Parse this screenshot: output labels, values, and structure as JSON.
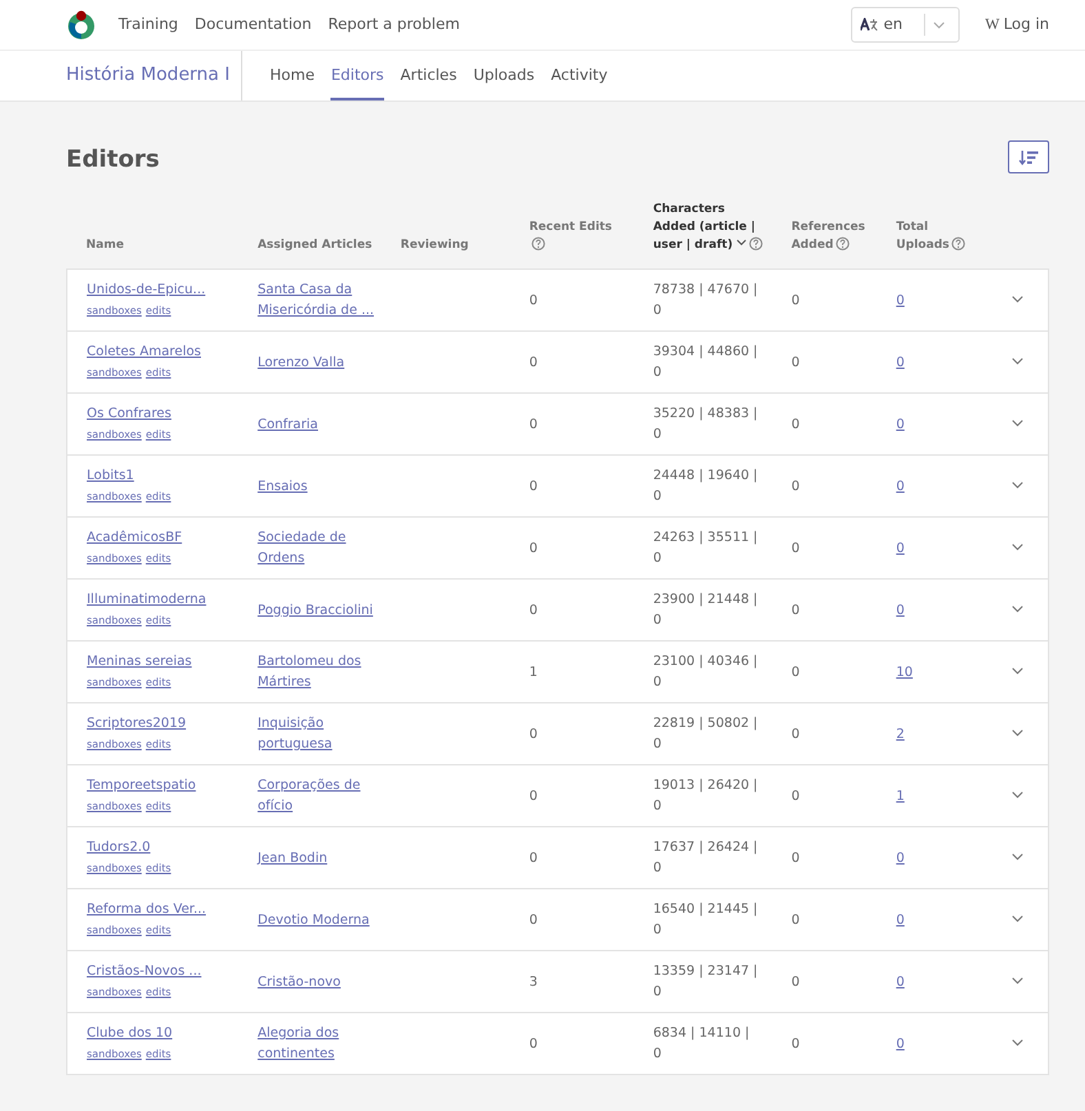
{
  "top_nav": {
    "links": [
      "Training",
      "Documentation",
      "Report a problem"
    ],
    "language": "en",
    "login_icon": "W",
    "login": "Log in"
  },
  "course_nav": {
    "title": "História Moderna I",
    "tabs": [
      {
        "label": "Home",
        "selected": false
      },
      {
        "label": "Editors",
        "selected": true
      },
      {
        "label": "Articles",
        "selected": false
      },
      {
        "label": "Uploads",
        "selected": false
      },
      {
        "label": "Activity",
        "selected": false
      }
    ]
  },
  "heading": "Editors",
  "table": {
    "columns": [
      {
        "label": "Name",
        "help": false,
        "sorted": false
      },
      {
        "label": "Assigned Articles",
        "help": false,
        "sorted": false
      },
      {
        "label": "Reviewing",
        "help": false,
        "sorted": false
      },
      {
        "label": "Recent Edits",
        "help": true,
        "sorted": false
      },
      {
        "label": "Characters Added (article | user | draft)",
        "help": true,
        "sorted": true
      },
      {
        "label": "References Added",
        "help": true,
        "sorted": false
      },
      {
        "label": "Total Uploads",
        "help": true,
        "sorted": false
      }
    ],
    "rows": [
      {
        "name": "Unidos-de-Epicu...",
        "links": [
          "sandboxes",
          "edits"
        ],
        "article": "Santa Casa da Misericórdia de ...",
        "recent_edits": "0",
        "characters": "78738 | 47670 | 0",
        "references": "0",
        "uploads": "0"
      },
      {
        "name": "Coletes Amarelos",
        "links": [
          "sandboxes",
          "edits"
        ],
        "article": "Lorenzo Valla",
        "recent_edits": "0",
        "characters": "39304 | 44860 | 0",
        "references": "0",
        "uploads": "0"
      },
      {
        "name": "Os Confrares",
        "links": [
          "sandboxes",
          "edits"
        ],
        "article": "Confraria",
        "recent_edits": "0",
        "characters": "35220 | 48383 | 0",
        "references": "0",
        "uploads": "0"
      },
      {
        "name": "Lobits1",
        "links": [
          "sandboxes",
          "edits"
        ],
        "article": "Ensaios",
        "recent_edits": "0",
        "characters": "24448 | 19640 | 0",
        "references": "0",
        "uploads": "0"
      },
      {
        "name": "AcadêmicosBF",
        "links": [
          "sandboxes",
          "edits"
        ],
        "article": "Sociedade de Ordens",
        "recent_edits": "0",
        "characters": "24263 | 35511 | 0",
        "references": "0",
        "uploads": "0"
      },
      {
        "name": "Illuminatimoderna",
        "links": [
          "sandboxes",
          "edits"
        ],
        "article": "Poggio Bracciolini",
        "recent_edits": "0",
        "characters": "23900 | 21448 | 0",
        "references": "0",
        "uploads": "0"
      },
      {
        "name": "Meninas sereias",
        "links": [
          "sandboxes",
          "edits"
        ],
        "article": "Bartolomeu dos Mártires",
        "recent_edits": "1",
        "characters": "23100 | 40346 | 0",
        "references": "0",
        "uploads": "10"
      },
      {
        "name": "Scriptores2019",
        "links": [
          "sandboxes",
          "edits"
        ],
        "article": "Inquisição portuguesa",
        "recent_edits": "0",
        "characters": "22819 | 50802 | 0",
        "references": "0",
        "uploads": "2"
      },
      {
        "name": "Temporeetspatio",
        "links": [
          "sandboxes",
          "edits"
        ],
        "article": "Corporações de ofício",
        "recent_edits": "0",
        "characters": "19013 | 26420 | 0",
        "references": "0",
        "uploads": "1"
      },
      {
        "name": "Tudors2.0",
        "links": [
          "sandboxes",
          "edits"
        ],
        "article": "Jean Bodin",
        "recent_edits": "0",
        "characters": "17637 | 26424 | 0",
        "references": "0",
        "uploads": "0"
      },
      {
        "name": "Reforma dos Ver...",
        "links": [
          "sandboxes",
          "edits"
        ],
        "article": "Devotio Moderna",
        "recent_edits": "0",
        "characters": "16540 | 21445 | 0",
        "references": "0",
        "uploads": "0"
      },
      {
        "name": "Cristãos-Novos ...",
        "links": [
          "sandboxes",
          "edits"
        ],
        "article": "Cristão-novo",
        "recent_edits": "3",
        "characters": "13359 | 23147 | 0",
        "references": "0",
        "uploads": "0"
      },
      {
        "name": "Clube dos 10",
        "links": [
          "sandboxes",
          "edits"
        ],
        "article": "Alegoria dos continentes",
        "recent_edits": "0",
        "characters": "6834 | 14110 | 0",
        "references": "0",
        "uploads": "0"
      }
    ]
  }
}
